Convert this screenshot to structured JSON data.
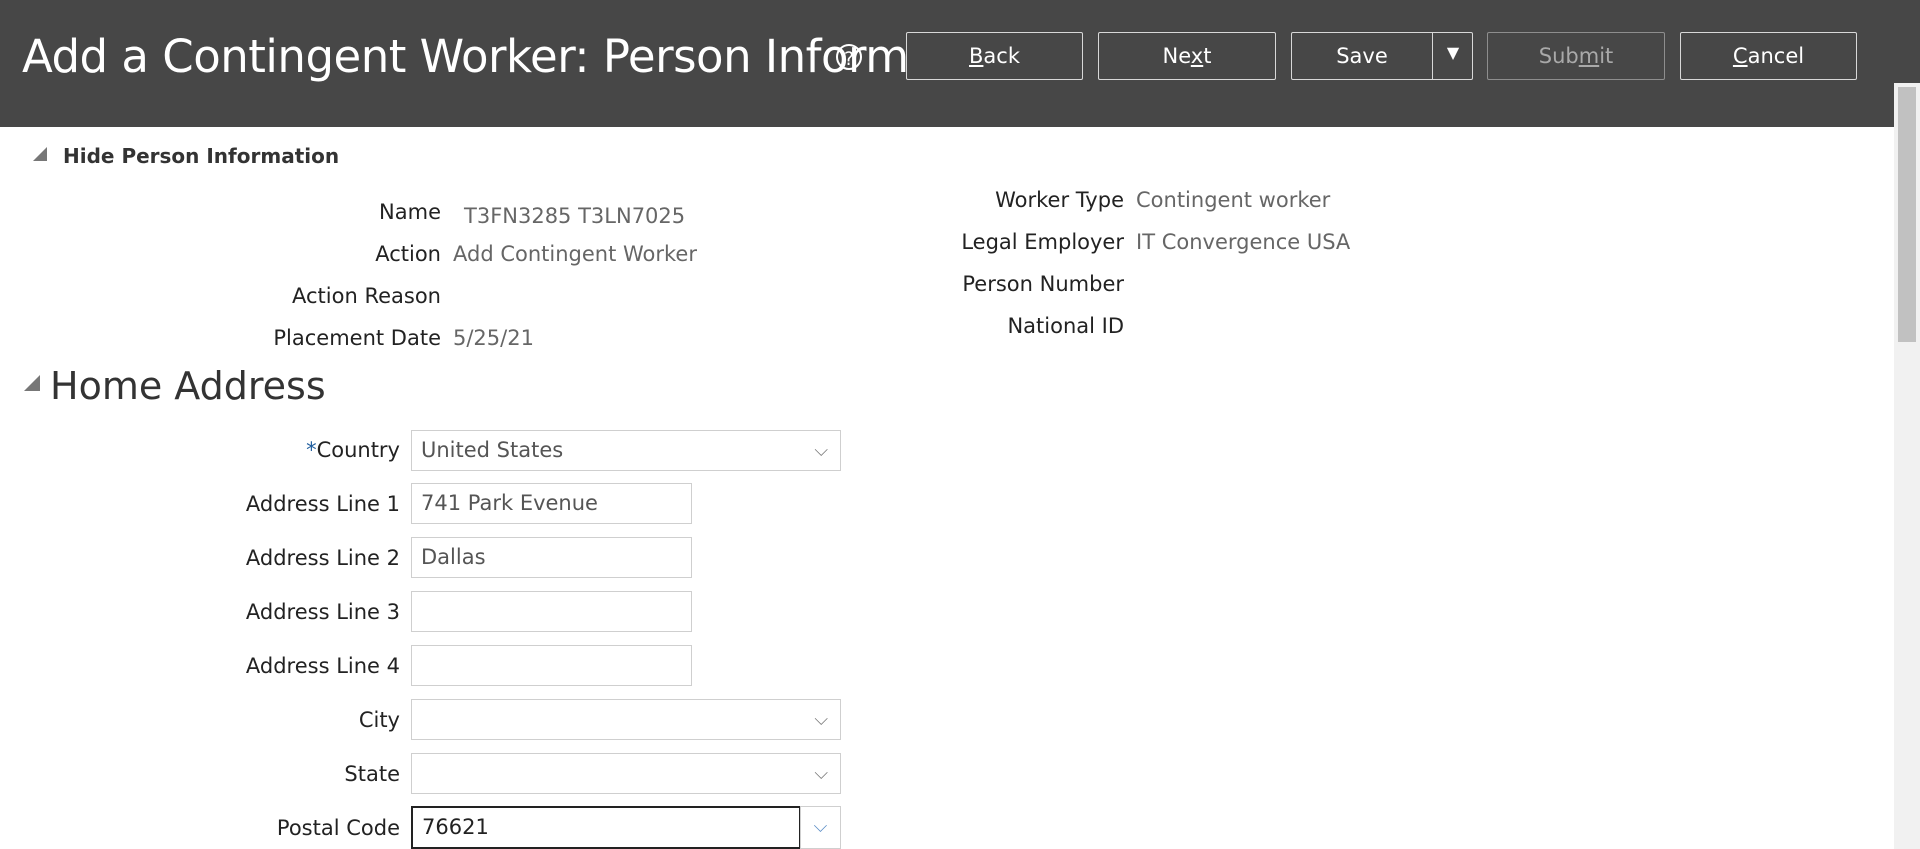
{
  "header": {
    "title": "Add a Contingent Worker: Person Inform...",
    "buttons": {
      "back": {
        "pre": "",
        "u": "B",
        "post": "ack"
      },
      "next": {
        "pre": "Ne",
        "u": "x",
        "post": "t"
      },
      "save": "Save",
      "submit": {
        "pre": "Sub",
        "u": "m",
        "post": "it"
      },
      "cancel": {
        "pre": "",
        "u": "C",
        "post": "ancel"
      }
    }
  },
  "person_info": {
    "toggle_label": "Hide Person Information",
    "labels": {
      "name": "Name",
      "action": "Action",
      "action_reason": "Action Reason",
      "placement_date": "Placement Date",
      "worker_type": "Worker Type",
      "legal_employer": "Legal Employer",
      "person_number": "Person Number",
      "national_id": "National ID"
    },
    "values": {
      "name": "T3FN3285 T3LN7025",
      "action": "Add Contingent Worker",
      "action_reason": "",
      "placement_date": "5/25/21",
      "worker_type": "Contingent worker",
      "legal_employer": "IT Convergence USA",
      "person_number": "",
      "national_id": ""
    }
  },
  "home_address": {
    "title": "Home Address",
    "required_mark": "*",
    "labels": {
      "country": "Country",
      "address1": "Address Line 1",
      "address2": "Address Line 2",
      "address3": "Address Line 3",
      "address4": "Address Line 4",
      "city": "City",
      "state": "State",
      "postal_code": "Postal Code"
    },
    "values": {
      "country": "United States",
      "address1": "741 Park Evenue",
      "address2": "Dallas",
      "address3": "",
      "address4": "",
      "city": "",
      "state": "",
      "postal_code": "76621"
    }
  },
  "icons": {
    "help": "question-circle-icon",
    "caret": "triangle-down-icon",
    "chevron": "chevron-down-icon"
  }
}
